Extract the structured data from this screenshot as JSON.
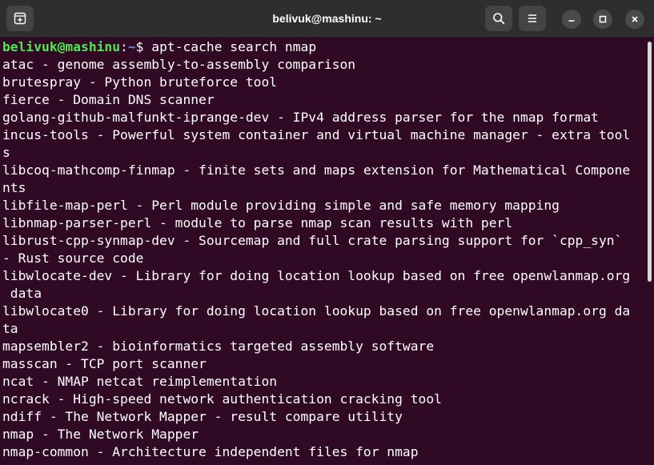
{
  "window": {
    "title": "belivuk@mashinu: ~",
    "icons": {
      "new_tab": "new-tab-icon",
      "search": "search-icon",
      "menu": "hamburger-menu-icon",
      "minimize": "minimize-icon",
      "maximize": "maximize-icon",
      "close": "close-icon"
    }
  },
  "colors": {
    "terminal_bg": "#300a24",
    "titlebar_bg": "#2e2e2e",
    "prompt_user": "#4ee94e",
    "prompt_path": "#6b8dd6",
    "text": "#ffffff"
  },
  "prompt": {
    "user_host": "belivuk@mashinu",
    "separator": ":",
    "path": "~",
    "symbol": "$ ",
    "command": "apt-cache search nmap"
  },
  "output": [
    "atac - genome assembly-to-assembly comparison",
    "brutespray - Python bruteforce tool",
    "fierce - Domain DNS scanner",
    "golang-github-malfunkt-iprange-dev - IPv4 address parser for the nmap format",
    "incus-tools - Powerful system container and virtual machine manager - extra tool",
    "s",
    "libcoq-mathcomp-finmap - finite sets and maps extension for Mathematical Compone",
    "nts",
    "libfile-map-perl - Perl module providing simple and safe memory mapping",
    "libnmap-parser-perl - module to parse nmap scan results with perl",
    "librust-cpp-synmap-dev - Sourcemap and full crate parsing support for `cpp_syn`",
    "- Rust source code",
    "libwlocate-dev - Library for doing location lookup based on free openwlanmap.org",
    " data",
    "libwlocate0 - Library for doing location lookup based on free openwlanmap.org da",
    "ta",
    "mapsembler2 - bioinformatics targeted assembly software",
    "masscan - TCP port scanner",
    "ncat - NMAP netcat reimplementation",
    "ncrack - High-speed network authentication cracking tool",
    "ndiff - The Network Mapper - result compare utility",
    "nmap - The Network Mapper",
    "nmap-common - Architecture independent files for nmap"
  ]
}
